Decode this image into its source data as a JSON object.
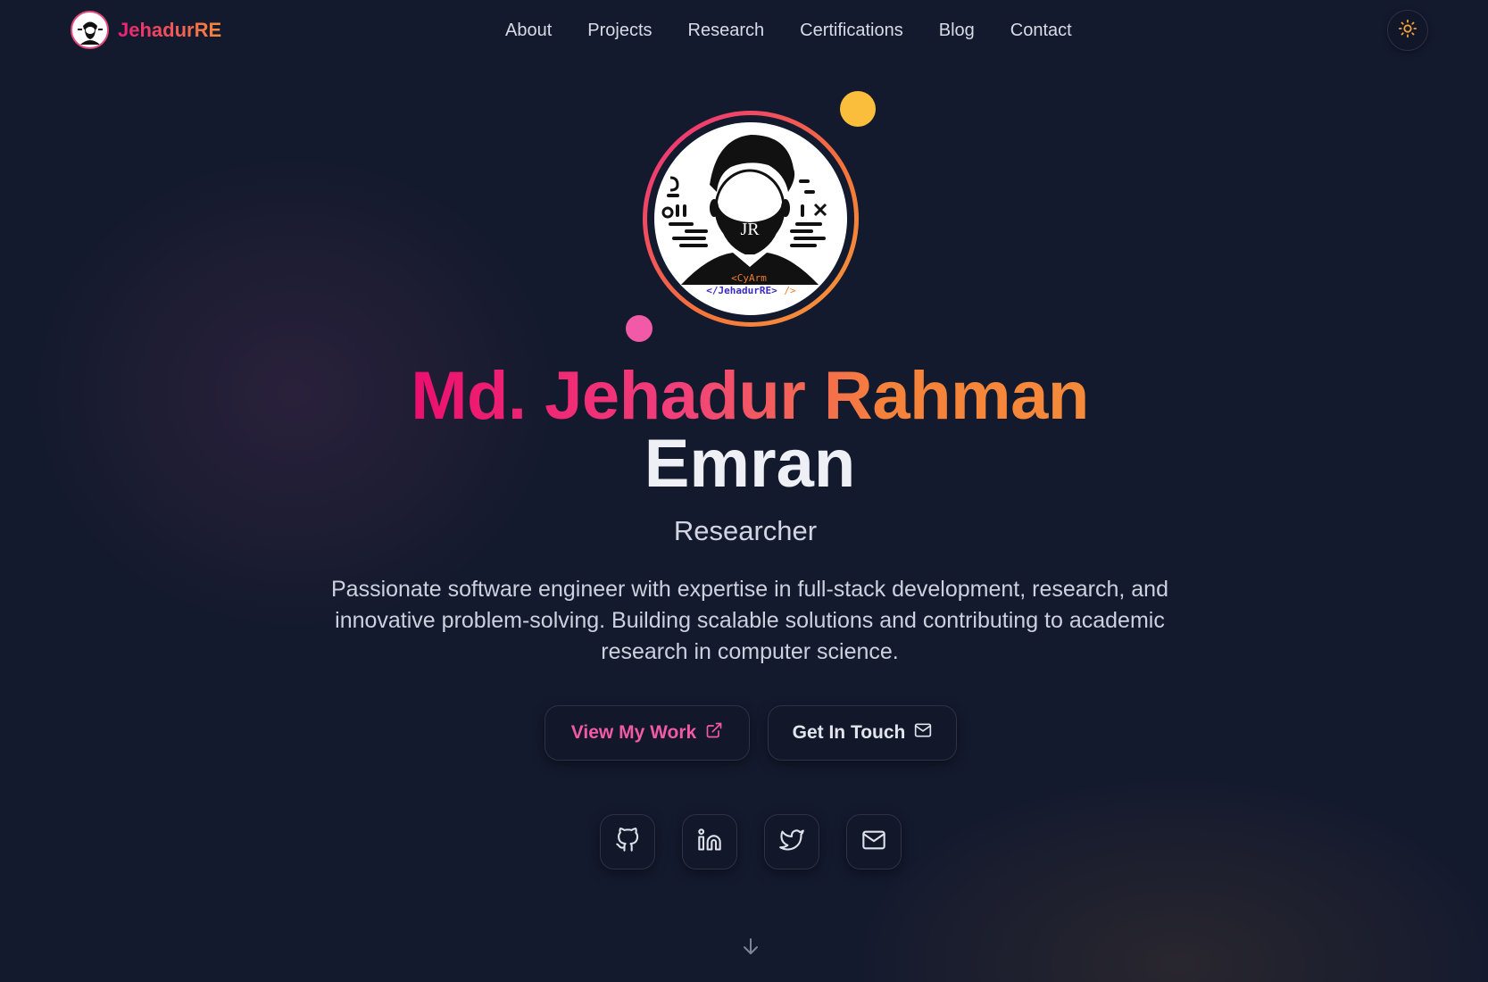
{
  "nav": {
    "brand": "JehadurRE",
    "links": [
      "About",
      "Projects",
      "Research",
      "Certifications",
      "Blog",
      "Contact"
    ]
  },
  "hero": {
    "avatar_caption_top": "<CyArm",
    "avatar_caption_bottom": "</JehadurRE>",
    "avatar_caption_end": "/>",
    "avatar_monogram": "JR",
    "name_gradient": "Md. Jehadur Rahman",
    "name_plain": "Emran",
    "role": "Researcher",
    "bio": "Passionate software engineer with expertise in full-stack development, research, and innovative problem-solving. Building scalable solutions and contributing to academic research in computer science.",
    "cta_primary": "View My Work",
    "cta_secondary": "Get In Touch"
  },
  "socials": [
    "github-icon",
    "linkedin-icon",
    "twitter-icon",
    "mail-icon"
  ],
  "colors": {
    "background": "#141a2e",
    "accent_pink": "#ec1d79",
    "accent_orange": "#f58a3a",
    "dot_yellow": "#fbbd3c",
    "dot_pink": "#f25aa8"
  }
}
